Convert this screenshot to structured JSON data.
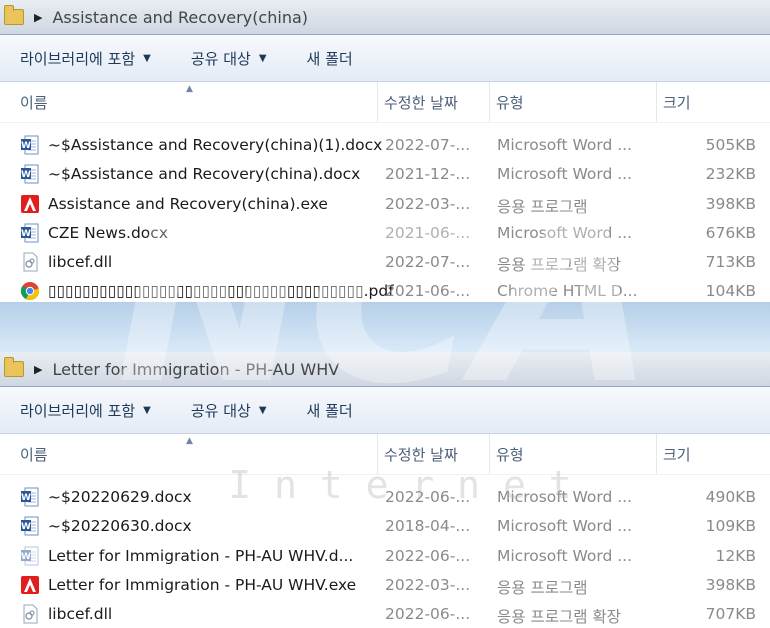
{
  "top": {
    "address": {
      "path": "Assistance and Recovery(china)"
    },
    "toolbar": {
      "include_library": "라이브러리에 포함",
      "share_with": "공유 대상",
      "new_folder": "새 폴더"
    },
    "columns": {
      "name": "이름",
      "date": "수정한 날짜",
      "type": "유형",
      "size": "크기"
    },
    "files": [
      {
        "icon": "word-doc-icon",
        "name": "~$Assistance and Recovery(china)(1).docx",
        "date": "2022-07-...",
        "type": "Microsoft Word ...",
        "size": "505KB"
      },
      {
        "icon": "word-doc-icon",
        "name": "~$Assistance and Recovery(china).docx",
        "date": "2021-12-...",
        "type": "Microsoft Word ...",
        "size": "232KB"
      },
      {
        "icon": "adobe-exe-icon",
        "name": "Assistance and Recovery(china).exe",
        "date": "2022-03-...",
        "type": "응용 프로그램",
        "size": "398KB"
      },
      {
        "icon": "word-doc-icon",
        "name": "CZE News.docx",
        "date": "2021-06-...",
        "type": "Microsoft Word ...",
        "size": "676KB"
      },
      {
        "icon": "dll-file-icon",
        "name": "libcef.dll",
        "date": "2022-07-...",
        "type": "응용 프로그램 확장",
        "size": "713KB"
      },
      {
        "icon": "chrome-pdf-icon",
        "name": "▯▯▯▯▯▯▯▯▯▯▯▯▯▯▯▯▯▯▯▯▯▯▯▯▯▯▯▯▯▯▯▯▯▯▯▯▯.pdf",
        "date": "2021-06-...",
        "type": "Chrome HTML D...",
        "size": "104KB"
      }
    ]
  },
  "bottom": {
    "address": {
      "path": "Letter for Immigration - PH-AU WHV"
    },
    "toolbar": {
      "include_library": "라이브러리에 포함",
      "share_with": "공유 대상",
      "new_folder": "새 폴더"
    },
    "columns": {
      "name": "이름",
      "date": "수정한 날짜",
      "type": "유형",
      "size": "크기"
    },
    "files": [
      {
        "icon": "word-doc-icon",
        "name": "~$20220629.docx",
        "date": "2022-06-...",
        "type": "Microsoft Word ...",
        "size": "490KB"
      },
      {
        "icon": "word-doc-icon",
        "name": "~$20220630.docx",
        "date": "2018-04-...",
        "type": "Microsoft Word ...",
        "size": "109KB"
      },
      {
        "icon": "word-doc-faded-icon",
        "name": "Letter for Immigration - PH-AU WHV.d...",
        "date": "2022-06-...",
        "type": "Microsoft Word ...",
        "size": "12KB"
      },
      {
        "icon": "adobe-exe-icon",
        "name": "Letter for Immigration - PH-AU WHV.exe",
        "date": "2022-03-...",
        "type": "응용 프로그램",
        "size": "398KB"
      },
      {
        "icon": "dll-file-icon",
        "name": "libcef.dll",
        "date": "2022-06-...",
        "type": "응용 프로그램 확장",
        "size": "707KB"
      }
    ]
  },
  "watermark": {
    "logo_text": "NCA",
    "sub_text": "I n t e r n e t"
  }
}
